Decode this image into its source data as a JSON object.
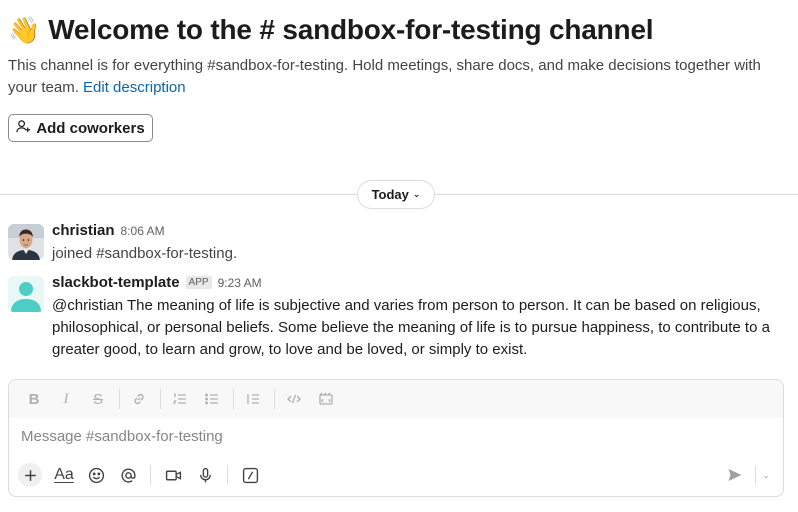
{
  "header": {
    "wave_emoji": "👋",
    "title": "Welcome to the # sandbox-for-testing channel",
    "description": "This channel is for everything #sandbox-for-testing. Hold meetings, share docs, and make decisions together with your team.",
    "edit_link": "Edit description"
  },
  "add_coworkers": {
    "label": "Add coworkers"
  },
  "date_divider": {
    "label": "Today"
  },
  "messages": [
    {
      "author": "christian",
      "time": "8:06 AM",
      "text": "joined #sandbox-for-testing."
    },
    {
      "author": "slackbot-template",
      "badge": "APP",
      "time": "9:23 AM",
      "text": "@christian The meaning of life is subjective and varies from person to person. It can be based on religious, philosophical, or personal beliefs. Some believe the meaning of life is to pursue happiness, to contribute to a greater good, to learn and grow, to love and be loved, or simply to exist."
    }
  ],
  "composer": {
    "placeholder": "Message #sandbox-for-testing",
    "format_buttons": [
      "bold-icon",
      "italic-icon",
      "strikethrough-icon",
      "link-icon",
      "ordered-list-icon",
      "bulleted-list-icon",
      "blockquote-icon",
      "code-icon",
      "code-block-icon"
    ],
    "tools": [
      "plus-icon",
      "formatting-icon",
      "emoji-icon",
      "mention-icon",
      "video-icon",
      "microphone-icon",
      "slash-shortcut-icon"
    ],
    "format_label": "Aa"
  },
  "colors": {
    "link": "#1264a3",
    "bot_avatar": "#4ecdc4",
    "text": "#1d1c1d"
  }
}
